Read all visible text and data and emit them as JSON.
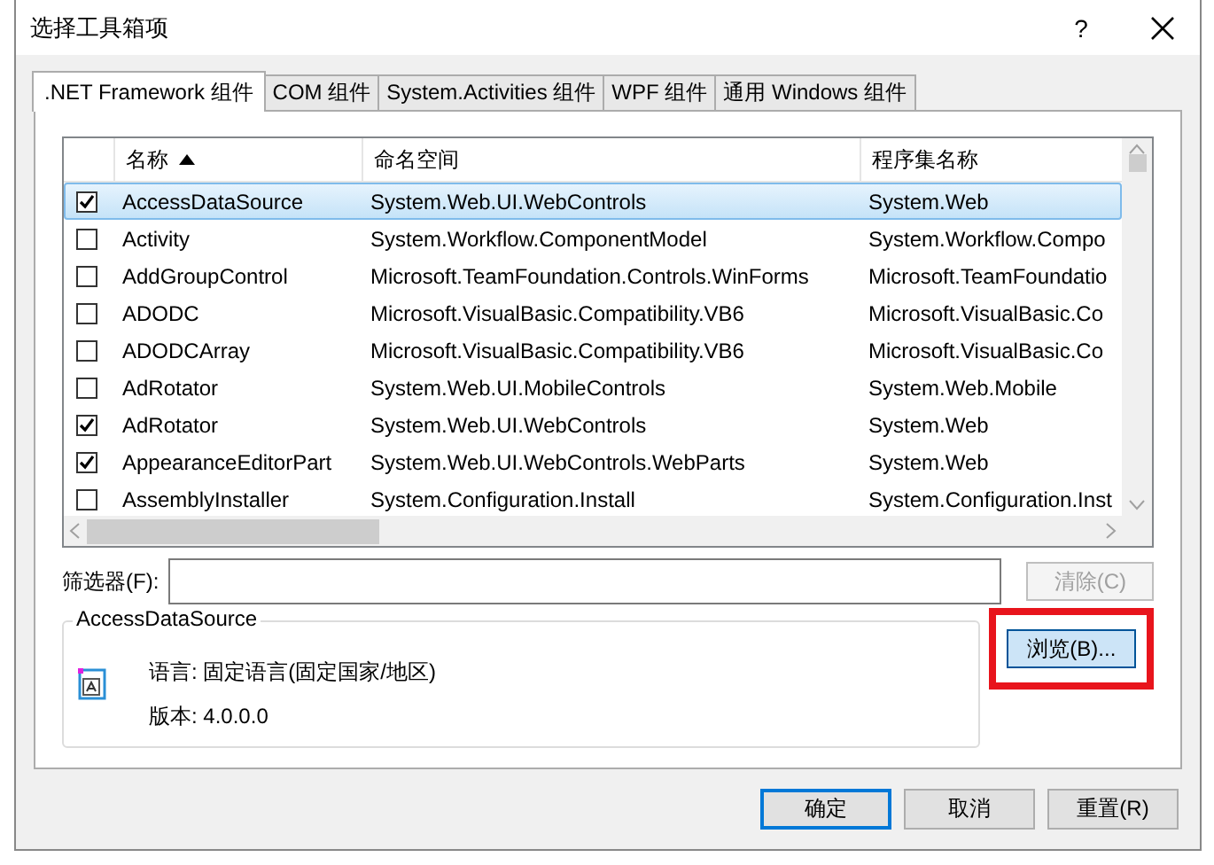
{
  "window": {
    "title": "选择工具箱项",
    "help": "?"
  },
  "tabs": [
    {
      "label": ".NET Framework 组件",
      "selected": true
    },
    {
      "label": "COM 组件",
      "selected": false
    },
    {
      "label": "System.Activities 组件",
      "selected": false
    },
    {
      "label": "WPF 组件",
      "selected": false
    },
    {
      "label": "通用 Windows 组件",
      "selected": false
    }
  ],
  "list": {
    "columns": [
      {
        "label": "名称",
        "sorted": true
      },
      {
        "label": "命名空间",
        "sorted": false
      },
      {
        "label": "程序集名称",
        "sorted": false
      }
    ],
    "rows": [
      {
        "name": "AccessDataSource",
        "namespace": "System.Web.UI.WebControls",
        "assembly": "System.Web",
        "checked": true,
        "selected": true
      },
      {
        "name": "Activity",
        "namespace": "System.Workflow.ComponentModel",
        "assembly": "System.Workflow.Compo",
        "checked": false,
        "selected": false
      },
      {
        "name": "AddGroupControl",
        "namespace": "Microsoft.TeamFoundation.Controls.WinForms",
        "assembly": "Microsoft.TeamFoundatio",
        "checked": false,
        "selected": false
      },
      {
        "name": "ADODC",
        "namespace": "Microsoft.VisualBasic.Compatibility.VB6",
        "assembly": "Microsoft.VisualBasic.Co",
        "checked": false,
        "selected": false
      },
      {
        "name": "ADODCArray",
        "namespace": "Microsoft.VisualBasic.Compatibility.VB6",
        "assembly": "Microsoft.VisualBasic.Co",
        "checked": false,
        "selected": false
      },
      {
        "name": "AdRotator",
        "namespace": "System.Web.UI.MobileControls",
        "assembly": "System.Web.Mobile",
        "checked": false,
        "selected": false
      },
      {
        "name": "AdRotator",
        "namespace": "System.Web.UI.WebControls",
        "assembly": "System.Web",
        "checked": true,
        "selected": false
      },
      {
        "name": "AppearanceEditorPart",
        "namespace": "System.Web.UI.WebControls.WebParts",
        "assembly": "System.Web",
        "checked": true,
        "selected": false
      },
      {
        "name": "AssemblyInstaller",
        "namespace": "System.Configuration.Install",
        "assembly": "System.Configuration.Inst",
        "checked": false,
        "selected": false
      }
    ]
  },
  "filter": {
    "label": "筛选器(F):"
  },
  "clear_button": {
    "label": "清除(C)",
    "disabled": true
  },
  "browse_button": {
    "label": "浏览(B)...",
    "highlighted": true
  },
  "details": {
    "title": "AccessDataSource",
    "language": "语言: 固定语言(固定国家/地区)",
    "version": "版本: 4.0.0.0"
  },
  "buttons": [
    {
      "label": "确定",
      "default": true
    },
    {
      "label": "取消",
      "default": false
    },
    {
      "label": "重置(R)",
      "default": false
    }
  ]
}
